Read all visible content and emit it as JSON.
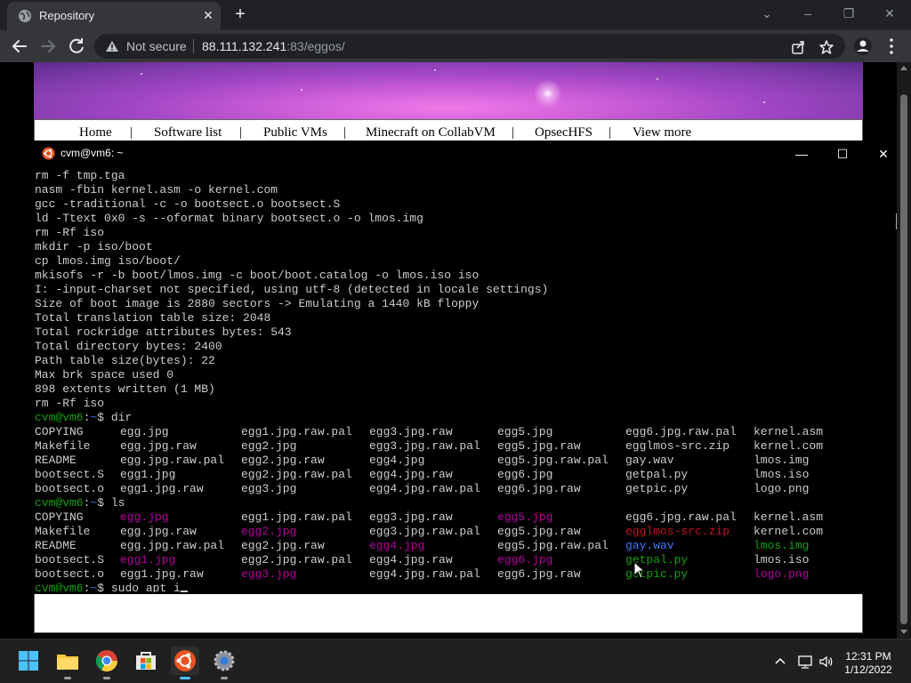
{
  "browser": {
    "tab_title": "Repository",
    "tab_close": "✕",
    "new_tab": "+",
    "window_controls": {
      "tab_search": "⌄",
      "minimize": "–",
      "restore": "❐",
      "close": "✕"
    },
    "omnibox": {
      "security_label": "Not secure",
      "host": "88.111.132.241",
      "path": ":83/eggos/"
    }
  },
  "site": {
    "nav": [
      {
        "label": "Home"
      },
      {
        "label": "|"
      },
      {
        "label": "Software list"
      },
      {
        "label": "|"
      },
      {
        "label": "Public VMs"
      },
      {
        "label": "|"
      },
      {
        "label": "Minecraft on CollabVM"
      },
      {
        "label": "|"
      },
      {
        "label": "OpsecHFS"
      },
      {
        "label": "|"
      },
      {
        "label": "View more"
      }
    ]
  },
  "terminal": {
    "title": "cvm@vm6: ~",
    "controls": {
      "minimize": "—",
      "maximize": "☐",
      "close": "✕"
    },
    "prompt": {
      "user": "cvm@vm6",
      "sep": ":",
      "path": "~",
      "symbol": "$ "
    },
    "lines": [
      "rm -f tmp.tga",
      "nasm -fbin kernel.asm -o kernel.com",
      "gcc -traditional -c -o bootsect.o bootsect.S",
      "ld -Ttext 0x0 -s --oformat binary bootsect.o -o lmos.img",
      "rm -Rf iso",
      "mkdir -p iso/boot",
      "cp lmos.img iso/boot/",
      "mkisofs -r -b boot/lmos.img -c boot/boot.catalog -o lmos.iso iso",
      "I: -input-charset not specified, using utf-8 (detected in locale settings)",
      "Size of boot image is 2880 sectors -> Emulating a 1440 kB floppy",
      "Total translation table size: 2048",
      "Total rockridge attributes bytes: 543",
      "Total directory bytes: 2400",
      "Path table size(bytes): 22",
      "Max brk space used 0",
      "898 extents written (1 MB)",
      "rm -Rf iso"
    ],
    "cmd_dir": "dir",
    "dir_rows": [
      [
        "COPYING",
        "egg.jpg",
        "egg1.jpg.raw.pal",
        "egg3.jpg.raw",
        "egg5.jpg",
        "egg6.jpg.raw.pal",
        "kernel.asm"
      ],
      [
        "Makefile",
        "egg.jpg.raw",
        "egg2.jpg",
        "egg3.jpg.raw.pal",
        "egg5.jpg.raw",
        "egglmos-src.zip",
        "kernel.com"
      ],
      [
        "README",
        "egg.jpg.raw.pal",
        "egg2.jpg.raw",
        "egg4.jpg",
        "egg5.jpg.raw.pal",
        "gay.wav",
        "lmos.img"
      ],
      [
        "bootsect.S",
        "egg1.jpg",
        "egg2.jpg.raw.pal",
        "egg4.jpg.raw",
        "egg6.jpg",
        "getpal.py",
        "lmos.iso"
      ],
      [
        "bootsect.o",
        "egg1.jpg.raw",
        "egg3.jpg",
        "egg4.jpg.raw.pal",
        "egg6.jpg.raw",
        "getpic.py",
        "logo.png"
      ]
    ],
    "cmd_ls": "ls",
    "ls_rows": [
      [
        "COPYING",
        "egg.jpg",
        "egg1.jpg.raw.pal",
        "egg3.jpg.raw",
        "egg5.jpg",
        "egg6.jpg.raw.pal",
        "kernel.asm"
      ],
      [
        "Makefile",
        "egg.jpg.raw",
        "egg2.jpg",
        "egg3.jpg.raw.pal",
        "egg5.jpg.raw",
        "egglmos-src.zip",
        "kernel.com"
      ],
      [
        "README",
        "egg.jpg.raw.pal",
        "egg2.jpg.raw",
        "egg4.jpg",
        "egg5.jpg.raw.pal",
        "gay.wav",
        "lmos.img"
      ],
      [
        "bootsect.S",
        "egg1.jpg",
        "egg2.jpg.raw.pal",
        "egg4.jpg.raw",
        "egg6.jpg",
        "getpal.py",
        "lmos.iso"
      ],
      [
        "bootsect.o",
        "egg1.jpg.raw",
        "egg3.jpg",
        "egg4.jpg.raw.pal",
        "egg6.jpg.raw",
        "getpic.py",
        "logo.png"
      ]
    ],
    "ls_colors": [
      [
        "",
        "mag",
        "",
        "",
        "mag",
        "",
        ""
      ],
      [
        "",
        "",
        "mag",
        "",
        "",
        "red",
        ""
      ],
      [
        "",
        "",
        "",
        "mag",
        "",
        "blu",
        "grn"
      ],
      [
        "",
        "mag",
        "",
        "",
        "mag",
        "grn",
        ""
      ],
      [
        "",
        "",
        "mag",
        "",
        "",
        "grn",
        "mag"
      ]
    ],
    "current_input": "sudo apt i"
  },
  "taskbar": {
    "apps": [
      {
        "name": "start-icon"
      },
      {
        "name": "file-explorer-icon"
      },
      {
        "name": "chrome-icon"
      },
      {
        "name": "microsoft-store-icon"
      },
      {
        "name": "ubuntu-icon"
      },
      {
        "name": "settings-icon"
      }
    ],
    "clock": {
      "time": "12:31 PM",
      "date": "1/12/2022"
    }
  },
  "colors": {
    "prompt_green": "#13a10e",
    "prompt_blue": "#3b78ff",
    "magenta": "#b4009e",
    "red": "#c50f1f",
    "accent": "#4cc2ff"
  }
}
